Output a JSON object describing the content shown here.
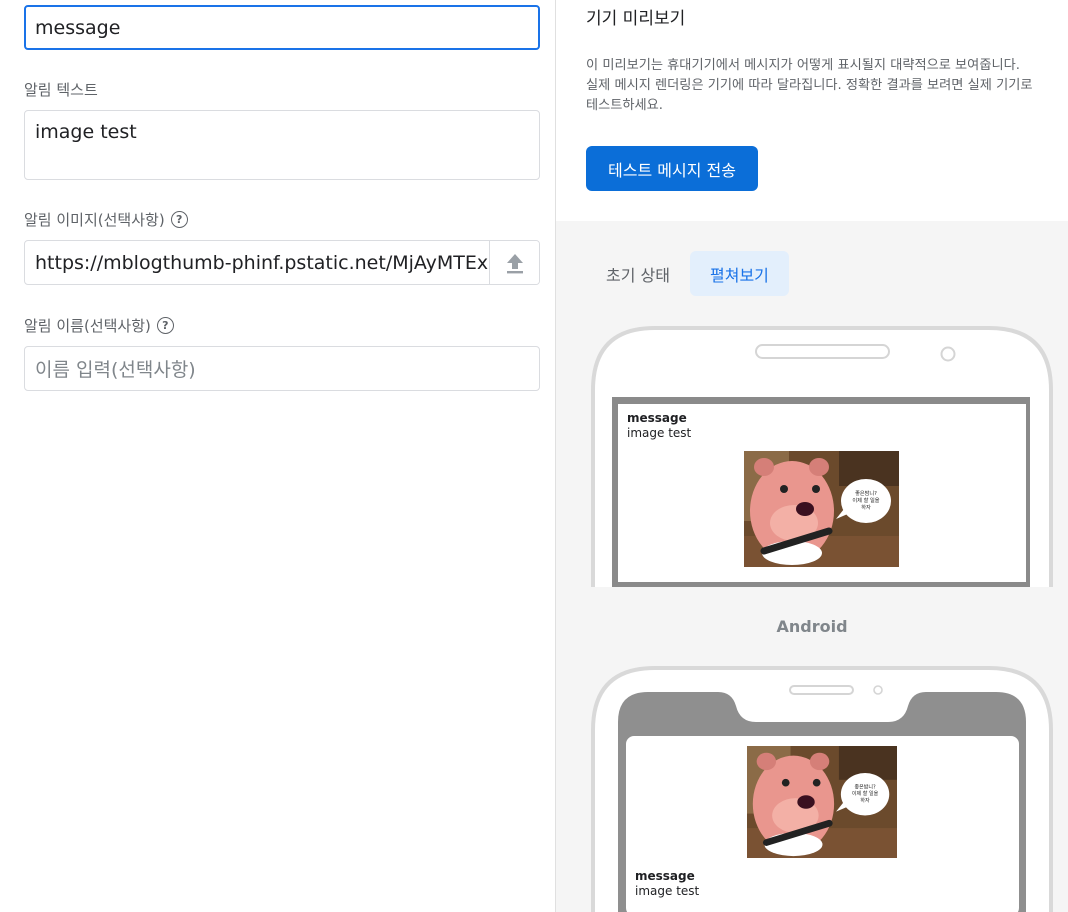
{
  "form": {
    "title_value": "message",
    "text_label": "알림 텍스트",
    "text_value": "image test",
    "image_label": "알림 이미지(선택사항)",
    "image_url": "https://mblogthumb-phinf.pstatic.net/MjAyMTExM",
    "name_label": "알림 이름(선택사항)",
    "name_placeholder": "이름 입력(선택사항)",
    "help_glyph": "?"
  },
  "preview": {
    "title": "기기 미리보기",
    "desc_line1": "이 미리보기는 휴대기기에서 메시지가 어떻게 표시될지 대략적으로 보여줍니다.",
    "desc_line2": "실제 메시지 렌더링은 기기에 따라 달라집니다. 정확한 결과를 보려면 실제 기기로",
    "desc_line3": "테스트하세요.",
    "send_button": "테스트 메시지 전송",
    "tabs": [
      {
        "label": "초기 상태",
        "active": false
      },
      {
        "label": "펼쳐보기",
        "active": true
      }
    ],
    "android_label": "Android",
    "notification": {
      "title": "message",
      "body": "image test",
      "speech_line1": "좋은밤니?",
      "speech_line2": "이제 할 일을",
      "speech_line3": "하자"
    }
  },
  "colors": {
    "accent": "#1a73e8",
    "button": "#0b6ed8",
    "tab_active_bg": "#e3effc"
  },
  "icons": [
    "help-circle-icon",
    "upload-icon"
  ]
}
